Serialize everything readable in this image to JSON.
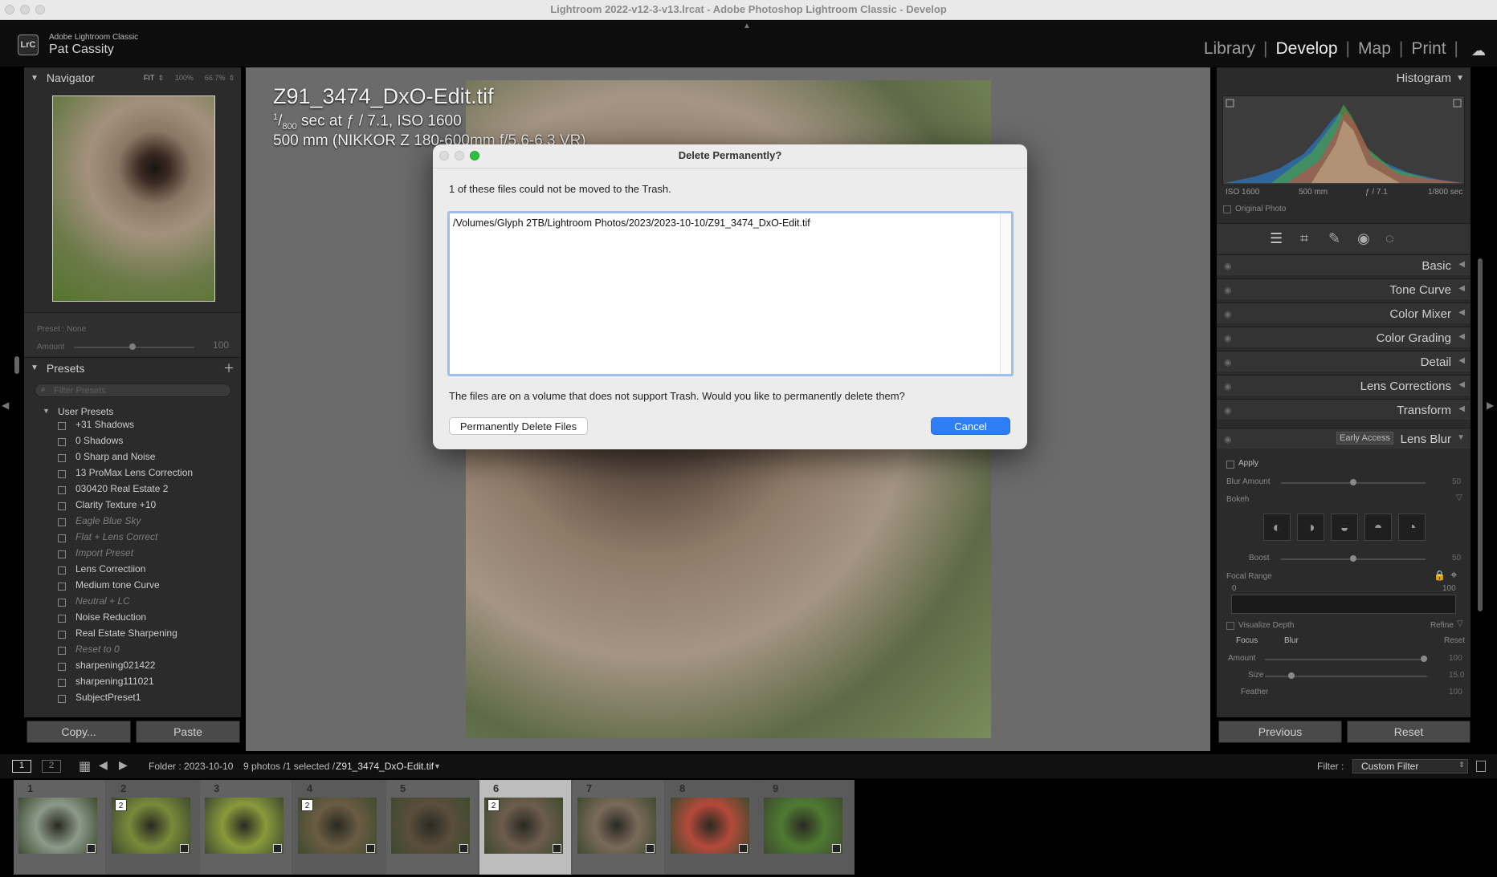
{
  "window": {
    "title": "Lightroom 2022-v12-3-v13.lrcat - Adobe Photoshop Lightroom Classic - Develop"
  },
  "identity": {
    "logo": "LrC",
    "app_name": "Adobe Lightroom Classic",
    "user": "Pat Cassity"
  },
  "modules": {
    "library": "Library",
    "develop": "Develop",
    "map": "Map",
    "print": "Print",
    "sep": "|"
  },
  "navigator": {
    "title": "Navigator",
    "zoom_fit": "FIT",
    "zoom_100": "100%",
    "zoom_667": "66.7%"
  },
  "preset_amount": {
    "preset_label": "Preset : None",
    "amount_label": "Amount",
    "amount_value": "100"
  },
  "presets": {
    "title": "Presets",
    "filter_placeholder": "Filter Presets",
    "group": "User Presets",
    "items": [
      {
        "label": "+31 Shadows"
      },
      {
        "label": "0 Shadows"
      },
      {
        "label": "0 Sharp and Noise"
      },
      {
        "label": "13 ProMax Lens Correction"
      },
      {
        "label": "030420 Real Estate 2"
      },
      {
        "label": "Clarity Texture +10"
      },
      {
        "label": "Eagle Blue Sky"
      },
      {
        "label": "Flat + Lens Correct"
      },
      {
        "label": "Import Preset"
      },
      {
        "label": "Lens Correctiion"
      },
      {
        "label": "Medium tone Curve"
      },
      {
        "label": "Neutral + LC"
      },
      {
        "label": "Noise Reduction"
      },
      {
        "label": "Real Estate Sharpening"
      },
      {
        "label": "Reset to 0"
      },
      {
        "label": "sharpening021422"
      },
      {
        "label": "sharpening111021"
      },
      {
        "label": "SubjectPreset1"
      }
    ]
  },
  "left_buttons": {
    "copy": "Copy...",
    "paste": "Paste"
  },
  "photo_info": {
    "filename": "Z91_3474_DxO-Edit.tif",
    "shutter_num": "1",
    "shutter_den": "800",
    "exposure_rest": " sec at ƒ / 7.1, ISO 1600",
    "lens": "500 mm (NIKKOR Z 180-600mm f/5.6-6.3 VR)"
  },
  "dialog": {
    "title": "Delete Permanently?",
    "message": "1 of these files could not be moved to the Trash.",
    "file_path": "/Volumes/Glyph 2TB/Lightroom Photos/2023/2023-10-10/Z91_3474_DxO-Edit.tif",
    "question": "The files are on a volume that does not support Trash.  Would you like to permanently delete them?",
    "delete_button": "Permanently Delete Files",
    "cancel_button": "Cancel"
  },
  "histogram": {
    "title": "Histogram",
    "iso": "ISO 1600",
    "focal": "500 mm",
    "aperture": "ƒ / 7.1",
    "shutter": "1/800 sec",
    "original_photo": "Original Photo"
  },
  "sections": [
    {
      "label": "Basic"
    },
    {
      "label": "Tone Curve"
    },
    {
      "label": "Color Mixer"
    },
    {
      "label": "Color Grading"
    },
    {
      "label": "Detail"
    },
    {
      "label": "Lens Corrections"
    },
    {
      "label": "Transform"
    }
  ],
  "lens_blur": {
    "title": "Lens Blur",
    "badge": "Early Access",
    "apply": "Apply",
    "blur_amount": "Blur Amount",
    "blur_amount_value": "50",
    "bokeh": "Bokeh",
    "boost": "Boost",
    "boost_value": "50",
    "focal_range": "Focal Range",
    "range_min": "0",
    "range_max": "100",
    "visualize_depth": "Visualize Depth",
    "refine": "Refine",
    "focus": "Focus",
    "blur": "Blur",
    "reset": "Reset",
    "amount": "Amount",
    "amount_value": "100",
    "size": "Size",
    "size_value": "15.0",
    "feather": "Feather",
    "feather_value": "100"
  },
  "right_buttons": {
    "previous": "Previous",
    "reset": "Reset"
  },
  "filmbar": {
    "view1": "1",
    "view2": "2",
    "folder": "Folder : 2023-10-10",
    "count": "9 photos /1 selected /",
    "selected": "Z91_3474_DxO-Edit.tif",
    "filter_label": "Filter :",
    "filter_value": "Custom Filter"
  },
  "thumbnails": [
    {
      "num": "1",
      "badge": "",
      "color": "#8c9a8a"
    },
    {
      "num": "2",
      "badge": "2",
      "color": "#7a8a3a"
    },
    {
      "num": "3",
      "badge": "",
      "color": "#8a9a3c"
    },
    {
      "num": "4",
      "badge": "2",
      "color": "#6b5c44"
    },
    {
      "num": "5",
      "badge": "",
      "color": "#5a4e3c"
    },
    {
      "num": "6",
      "badge": "2",
      "color": "#6d5c4e"
    },
    {
      "num": "7",
      "badge": "",
      "color": "#7a6a5a"
    },
    {
      "num": "8",
      "badge": "",
      "color": "#b44a3a"
    },
    {
      "num": "9",
      "badge": "",
      "color": "#4f7a32"
    }
  ]
}
